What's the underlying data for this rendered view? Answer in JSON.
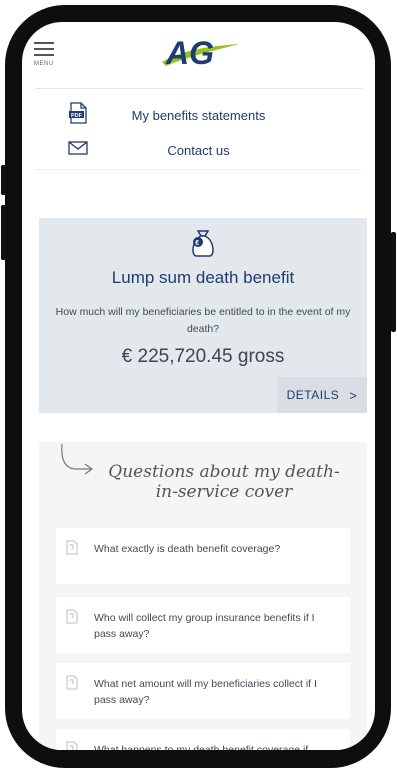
{
  "header": {
    "menu_label": "MENU",
    "logo_text": "AG"
  },
  "links": [
    {
      "icon": "pdf-icon",
      "label": "My benefits statements"
    },
    {
      "icon": "envelope-icon",
      "label": "Contact us"
    }
  ],
  "benefit_card": {
    "icon": "money-bag-icon",
    "title": "Lump sum death benefit",
    "question": "How much will my beneficiaries be entitled to in the event of my death?",
    "amount": "€ 225,720.45 gross",
    "details_label": "DETAILS",
    "details_chevron": ">"
  },
  "faq": {
    "heading": "Questions about my death-in-service cover",
    "items": [
      {
        "icon": "document-icon",
        "text": "What exactly is death benefit coverage?"
      },
      {
        "icon": "document-icon",
        "text": "Who will collect my group insurance benefits if I pass away?"
      },
      {
        "icon": "document-icon",
        "text": "What net amount will my beneficiaries collect if I pass away?"
      },
      {
        "icon": "document-icon",
        "text": "What happens to my death benefit coverage if"
      }
    ]
  },
  "colors": {
    "brand_navy": "#1f3b70",
    "brand_green": "#9ac11e",
    "card_bg": "#e3e8ec",
    "faq_bg": "#f4f5f7"
  }
}
